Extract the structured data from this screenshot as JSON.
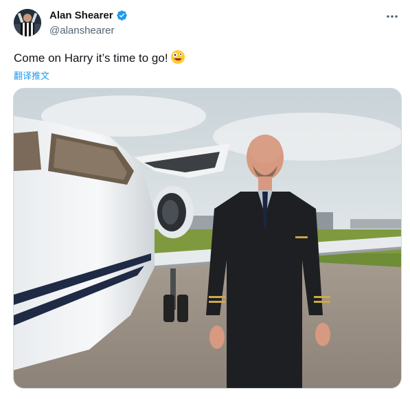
{
  "author": {
    "name": "Alan Shearer",
    "handle": "@alanshearer",
    "verified": true,
    "avatar_icon": "avatar-photo"
  },
  "tweet": {
    "text": "Come on Harry it’s time to go!",
    "emoji": "zany-face-emoji",
    "translate_label": "翻译推文"
  },
  "media": {
    "description_icon": "photo-pilot-jet"
  },
  "icons": {
    "verified": "verified-badge-icon",
    "more": "more-options-icon"
  },
  "colors": {
    "accent": "#1d9bf0",
    "text": "#0f1419",
    "secondary": "#536471"
  }
}
